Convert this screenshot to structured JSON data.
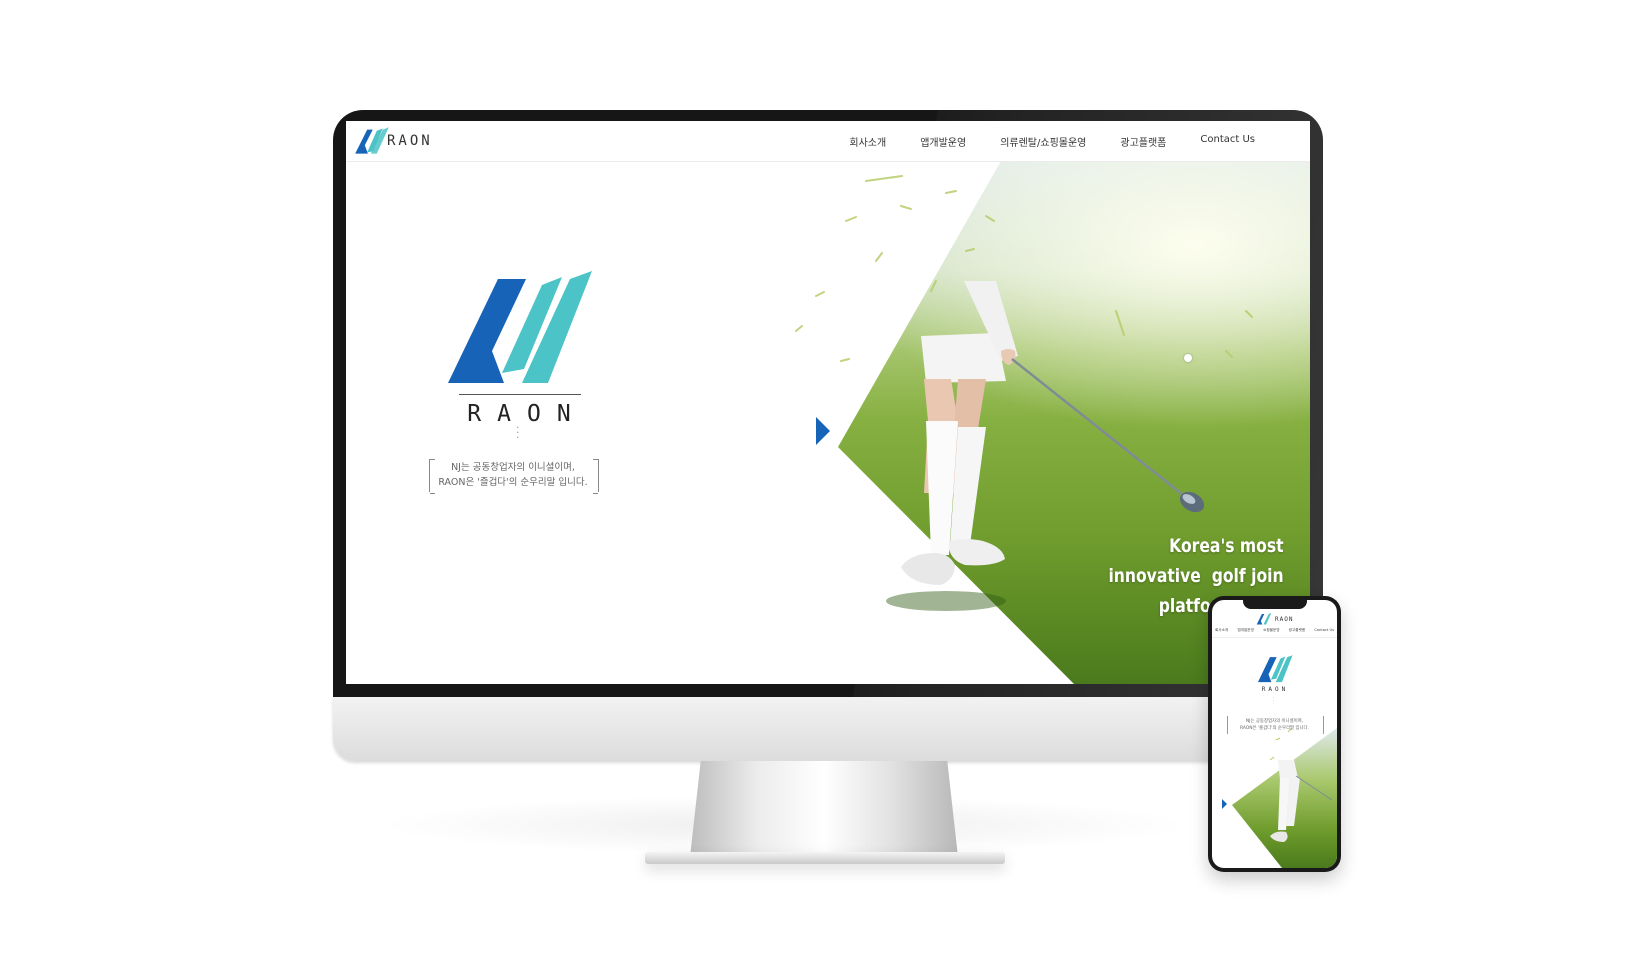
{
  "brand": {
    "name": "RAON"
  },
  "colors": {
    "brand_blue": "#1663b8",
    "brand_teal": "#4cc3c6",
    "arrow_blue": "#1663b8"
  },
  "desktop": {
    "nav": {
      "logo_text": "RAON",
      "items": [
        "회사소개",
        "앱개발운영",
        "의류렌탈/쇼핑몰운영",
        "광고플랫폼",
        "Contact Us"
      ]
    },
    "hero": {
      "wordmark": "RAON",
      "quote_line1": "NJ는 공동창업자의 이니셜이며,",
      "quote_line2": "RAON은 '즐겁다'의 순우리말 입니다."
    },
    "golf": {
      "tagline": "Korea's most\ninnovative  golf join\nplatform  appl"
    }
  },
  "mobile": {
    "nav": {
      "logo_text": "RAON",
      "items": [
        "회사소개",
        "앱개발운영",
        "쇼핑몰운영",
        "광고플랫폼",
        "Contact Us"
      ]
    },
    "hero": {
      "wordmark": "RAON",
      "quote_line1": "NJ는 공동창업자의 이니셜이며,",
      "quote_line2": "RAON은 '즐겁다'의 순우리말 입니다."
    }
  }
}
